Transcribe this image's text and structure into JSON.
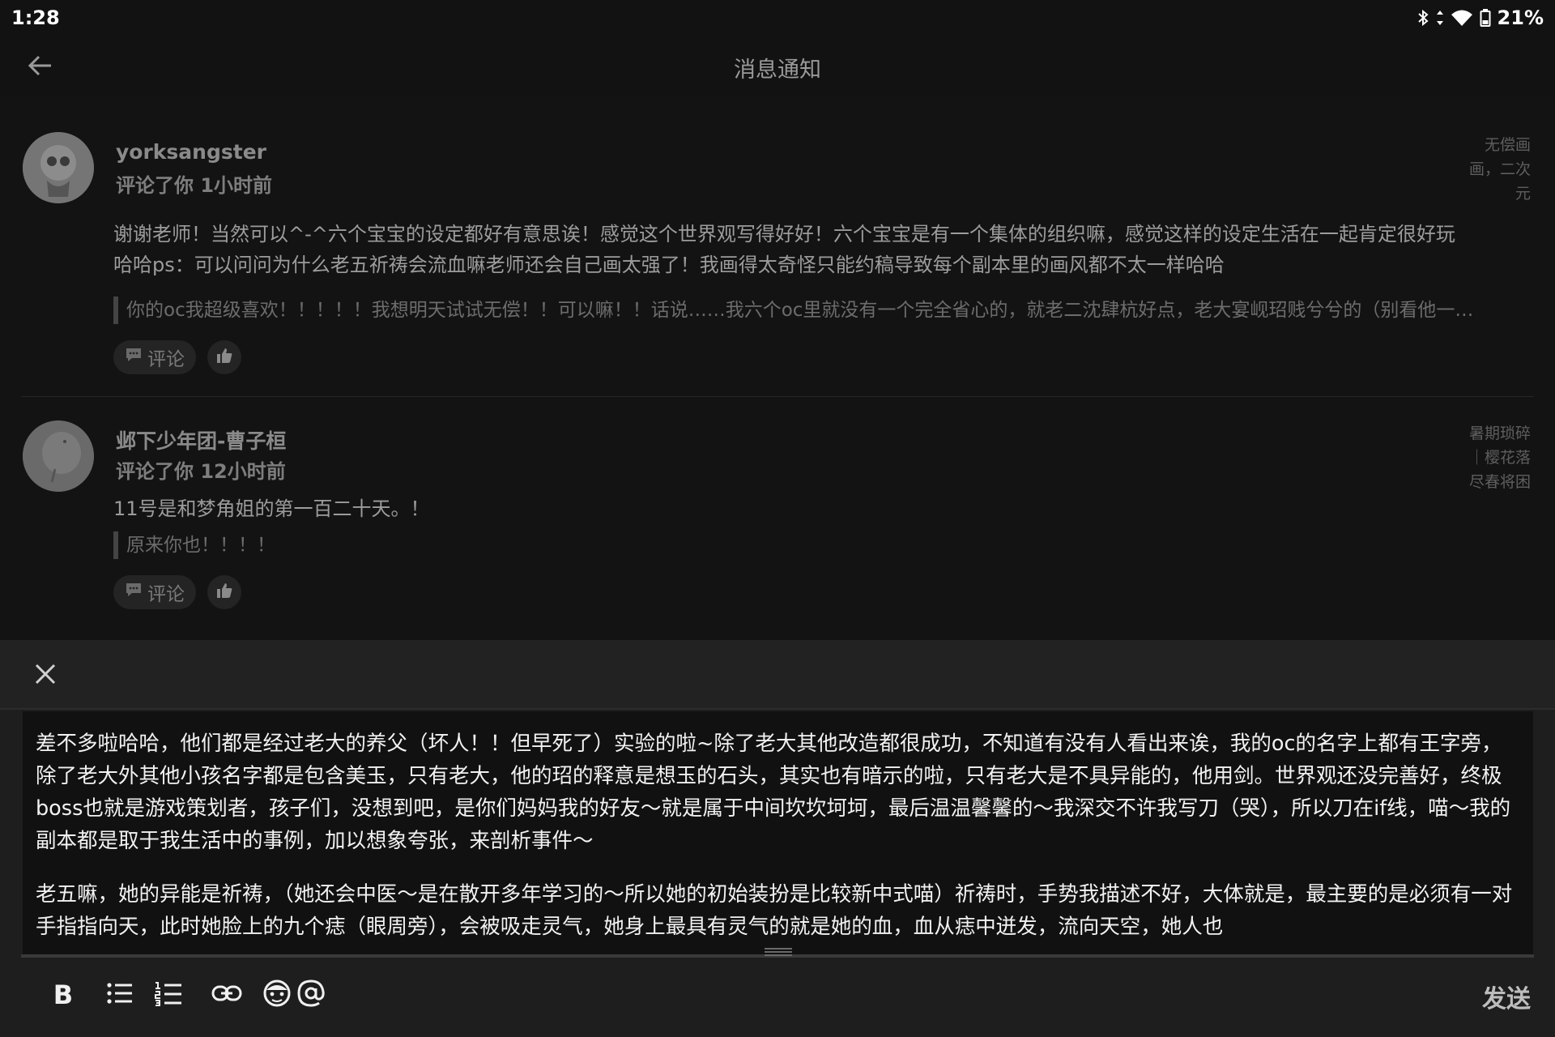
{
  "status_bar": {
    "time": "1:28",
    "battery": "21%",
    "icons": [
      "bluetooth-icon",
      "data-arrows-icon",
      "wifi-icon",
      "battery-icon"
    ]
  },
  "header": {
    "title": "消息通知",
    "back_icon": "arrow-left-icon"
  },
  "notifications": [
    {
      "user": "yorksangster",
      "meta": "评论了你 1小时前",
      "tag": "无偿画画，二次元",
      "text": "谢谢老师！当然可以^-^六个宝宝的设定都好有意思诶！感觉这个世界观写得好好！六个宝宝是有一个集体的组织嘛，感觉这样的设定生活在一起肯定很好玩哈哈ps：可以问问为什么老五祈祷会流血嘛老师还会自己画太强了！我画得太奇怪只能约稿导致每个副本里的画风都不太一样哈哈",
      "quote": "你的oc我超级喜欢！！！！！我想明天试试无偿！！可以嘛！！话说……我六个oc里就没有一个完全省心的，就老二沈肆杭好点，老大宴岘玿贱兮兮的（别看他一…",
      "comment_label": "评论"
    },
    {
      "user": "邺下少年团-曹子桓",
      "meta": "评论了你 12小时前",
      "tag": "暑期琐碎｜樱花落尽春将困",
      "text": "11号是和梦角姐的第一百二十天。！",
      "quote": "原来你也！！！！",
      "comment_label": "评论"
    }
  ],
  "editor": {
    "close_icon": "close-icon",
    "paragraphs": [
      "差不多啦哈哈，他们都是经过老大的养父（坏人！！但早死了）实验的啦~除了老大其他改造都很成功，不知道有没有人看出来诶，我的oc的名字上都有王字旁，除了老大外其他小孩名字都是包含美玉，只有老大，他的玿的释意是想玉的石头，其实也有暗示的啦，只有老大是不具异能的，他用剑。世界观还没完善好，终极boss也就是游戏策划者，孩子们，没想到吧，是你们妈妈我的好友～就是属于中间坎坎坷坷，最后温温馨馨的～我深交不许我写刀（哭），所以刀在if线，喵～我的副本都是取于我生活中的事例，加以想象夸张，来剖析事件～",
      "老五嘛，她的异能是祈祷，（她还会中医～是在散开多年学习的～所以她的初始装扮是比较新中式喵）祈祷时，手势我描述不好，大体就是，最主要的是必须有一对手指指向天，此时她脸上的九个痣（眼周旁），会被吸走灵气，她身上最具有灵气的就是她的血，血从痣中迸发，流向天空，她人也"
    ],
    "toolbar": {
      "bold_label": "B",
      "tools": [
        "bold-icon",
        "bullet-list-icon",
        "numbered-list-icon",
        "link-icon",
        "emoji-icon",
        "mention-icon"
      ],
      "send_label": "发送"
    }
  }
}
